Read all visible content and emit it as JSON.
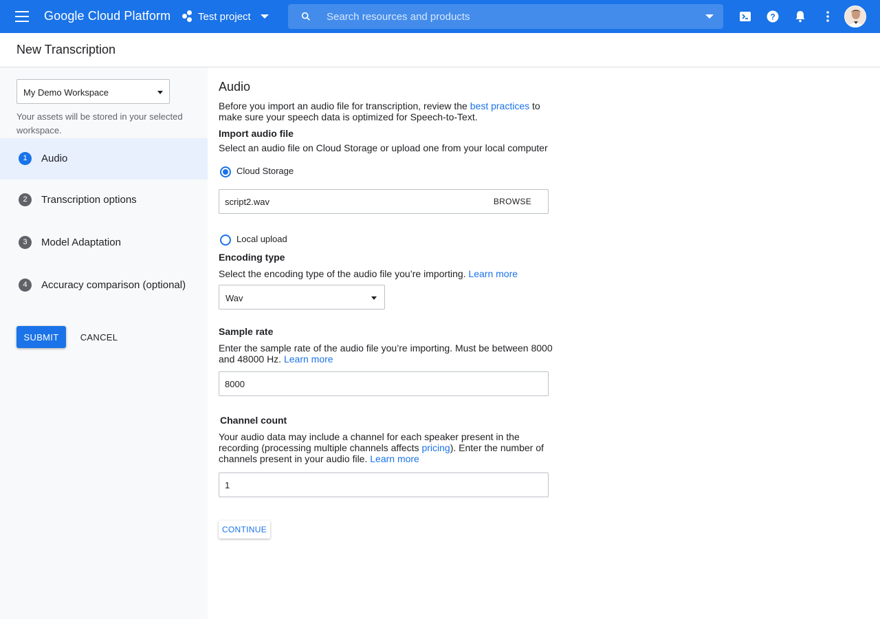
{
  "topbar": {
    "brand": "Google Cloud Platform",
    "project": "Test project",
    "search_placeholder": "Search resources and products",
    "icons": [
      "menu-icon",
      "project-icon",
      "search-icon",
      "cloud-shell-icon",
      "help-icon",
      "notifications-icon",
      "more-icon",
      "avatar"
    ],
    "color": "#1a73e8"
  },
  "page": {
    "title": "New Transcription"
  },
  "sidebar": {
    "workspace": "My Demo Workspace",
    "workspace_note": "Your assets will be stored in your selected workspace.",
    "steps": [
      {
        "num": "1",
        "label": "Audio",
        "active": true
      },
      {
        "num": "2",
        "label": "Transcription options"
      },
      {
        "num": "3",
        "label": "Model Adaptation"
      },
      {
        "num": "4",
        "label": "Accuracy comparison (optional)"
      }
    ],
    "submit": "SUBMIT",
    "cancel": "CANCEL"
  },
  "form": {
    "heading": "Audio",
    "intro_before": "Before you import an audio file for transcription, review the ",
    "intro_link": "best practices",
    "intro_after": " to make sure your speech data is optimized for Speech-to-Text.",
    "import_label": "Import audio file",
    "import_desc": "Select an audio file on Cloud Storage or upload one from your local computer",
    "cloud_storage": "Cloud Storage",
    "cloud_file": "script2.wav",
    "browse": "BROWSE",
    "local_upload": "Local upload",
    "encoding_label": "Encoding type",
    "encoding_desc": "Select the encoding type of the audio file you’re importing. ",
    "learn_more": "Learn more",
    "encoding_value": "Wav",
    "sample_label": "Sample rate",
    "sample_desc": "Enter the sample rate of the audio file you’re importing. Must be between 8000 and 48000 Hz. ",
    "sample_value": "8000",
    "channel_label": "Channel count",
    "channel_desc_before": "Your audio data may include a channel for each speaker present in the recording (processing multiple channels affects ",
    "channel_link": "pricing",
    "channel_desc_after": "). Enter the number of channels present in your audio file. ",
    "channel_value": "1",
    "continue": "CONTINUE"
  }
}
